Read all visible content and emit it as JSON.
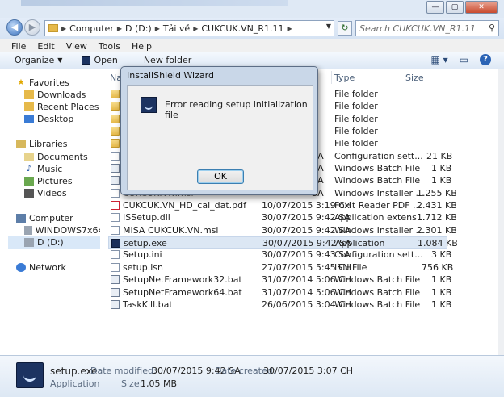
{
  "window": {
    "title_blurred": ""
  },
  "address": {
    "crumbs": [
      "Computer",
      "D (D:)",
      "Tải về",
      "CUKCUK.VN_R1.11"
    ],
    "search_placeholder": "Search CUKCUK.VN_R1.11"
  },
  "menu": [
    "File",
    "Edit",
    "View",
    "Tools",
    "Help"
  ],
  "toolbar": {
    "organize": "Organize",
    "open": "Open",
    "new_folder": "New folder"
  },
  "columns": {
    "name": "Name",
    "type": "Type",
    "size": "Size"
  },
  "nav": {
    "favorites": "Favorites",
    "downloads": "Downloads",
    "recent": "Recent Places",
    "desktop": "Desktop",
    "libraries": "Libraries",
    "documents": "Documents",
    "music": "Music",
    "pictures": "Pictures",
    "videos": "Videos",
    "computer": "Computer",
    "drive_c": "WINDOWS7x64 (C:)",
    "drive_d": "D (D:)",
    "network": "Network"
  },
  "files": [
    {
      "name": "",
      "date": "",
      "type": "File folder",
      "size": ""
    },
    {
      "name": "",
      "date": "",
      "type": "File folder",
      "size": ""
    },
    {
      "name": "",
      "date": "",
      "type": "File folder",
      "size": ""
    },
    {
      "name": "",
      "date": "",
      "type": "File folder",
      "size": ""
    },
    {
      "name": "",
      "date": "",
      "type": "File folder",
      "size": ""
    },
    {
      "name": "",
      "date": "",
      "type": "Configuration sett...",
      "size": "21 KB"
    },
    {
      "name": "",
      "date": "",
      "type": "Windows Batch File",
      "size": "1 KB"
    },
    {
      "name": "",
      "date": "",
      "type": "Windows Batch File",
      "size": "1 KB"
    },
    {
      "name": "",
      "date": "",
      "type": "Windows Installer ...",
      "size": "1.255 KB"
    },
    {
      "name": "CUKCUK.VN_HD_cai_dat.pdf",
      "date": "10/07/2015 3:19 CH",
      "type": "Foxit Reader PDF ...",
      "size": "2.431 KB"
    },
    {
      "name": "ISSetup.dll",
      "date": "30/07/2015 9:42 SA",
      "type": "Application extens...",
      "size": "1.712 KB"
    },
    {
      "name": "MISA CUKCUK.VN.msi",
      "date": "30/07/2015 9:42 SA",
      "type": "Windows Installer ...",
      "size": "2.301 KB"
    },
    {
      "name": "setup.exe",
      "date": "30/07/2015 9:42 SA",
      "type": "Application",
      "size": "1.084 KB"
    },
    {
      "name": "Setup.ini",
      "date": "30/07/2015 9:43 SA",
      "type": "Configuration sett...",
      "size": "3 KB"
    },
    {
      "name": "setup.isn",
      "date": "27/07/2015 5:45 CH",
      "type": "ISN File",
      "size": "756 KB"
    },
    {
      "name": "SetupNetFramework32.bat",
      "date": "31/07/2014 5:06 CH",
      "type": "Windows Batch File",
      "size": "1 KB"
    },
    {
      "name": "SetupNetFramework64.bat",
      "date": "31/07/2014 5:06 CH",
      "type": "Windows Batch File",
      "size": "1 KB"
    },
    {
      "name": "TaskKill.bat",
      "date": "26/06/2015 3:04 CH",
      "type": "Windows Batch File",
      "size": "1 KB"
    }
  ],
  "partial_dates": [
    "SA",
    "SA",
    "SA",
    "SA"
  ],
  "partial_name": "CUKCUK.VN.msi",
  "status": {
    "name": "setup.exe",
    "kind": "Application",
    "modified_label": "Date modified:",
    "modified": "30/07/2015 9:42 SA",
    "created_label": "Date created:",
    "created": "30/07/2015 3:07 CH",
    "size_label": "Size:",
    "size": "1,05 MB"
  },
  "dialog": {
    "title": "InstallShield Wizard",
    "message": "Error reading setup initialization file",
    "ok": "OK"
  }
}
